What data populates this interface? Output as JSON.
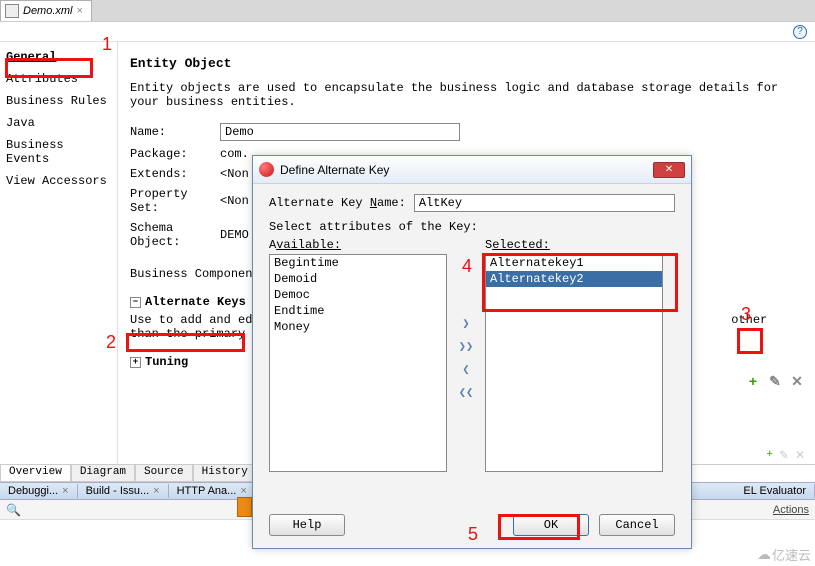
{
  "file_tab": {
    "name": "Demo.xml"
  },
  "side_nav": {
    "items": [
      {
        "label": "General",
        "active": true
      },
      {
        "label": "Attributes"
      },
      {
        "label": "Business Rules"
      },
      {
        "label": "Java"
      },
      {
        "label": "Business Events"
      },
      {
        "label": "View Accessors"
      }
    ]
  },
  "page": {
    "title": "Entity Object",
    "description": "Entity objects are used to encapsulate the business logic and database storage details for your business entities.",
    "form": {
      "name_label": "Name:",
      "name_value": "Demo",
      "package_label": "Package:",
      "package_value": "com.",
      "extends_label": "Extends:",
      "extends_value": "<Non",
      "propset_label": "Property Set:",
      "propset_value": "<Non",
      "schema_label": "Schema Object:",
      "schema_value": "DEMO",
      "bc_label": "Business Components"
    },
    "alt_keys_header": "Alternate Keys",
    "alt_keys_help_a": "Use to add and edit",
    "alt_keys_help_b": "other than the primary key",
    "tuning_header": "Tuning"
  },
  "bottom_tabs": [
    "Overview",
    "Diagram",
    "Source",
    "History"
  ],
  "panel_tabs": {
    "left": [
      "Debuggi...",
      "Build - Issu...",
      "HTTP Ana..."
    ],
    "right": [
      "EL Evaluator"
    ]
  },
  "search_bar": {
    "actions": "Actions"
  },
  "dialog": {
    "title": "Define Alternate Key",
    "name_label": "Alternate Key Name:",
    "name_value": "AltKey",
    "select_label": "Select attributes of the Key:",
    "available_label": "Available:",
    "selected_label": "Selected:",
    "available": [
      "Begintime",
      "Demoid",
      "Democ",
      "Endtime",
      "Money"
    ],
    "selected": [
      "Alternatekey1",
      "Alternatekey2"
    ],
    "selected_index": 1,
    "buttons": {
      "help": "Help",
      "ok": "OK",
      "cancel": "Cancel"
    }
  },
  "annotations": {
    "n1": "1",
    "n2": "2",
    "n3": "3",
    "n4": "4",
    "n5": "5"
  },
  "watermark": "亿速云"
}
